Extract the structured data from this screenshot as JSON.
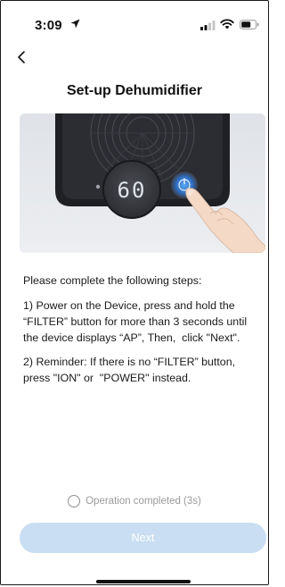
{
  "status_bar": {
    "time": "3:09"
  },
  "header": {
    "back_icon": "chevron-left-icon",
    "title": "Set-up Dehumidifier"
  },
  "hero": {
    "display_reading": "60"
  },
  "instructions": {
    "intro": "Please complete the following steps:",
    "step1": "1) Power on the Device, press and hold the “FILTER” button for more than 3 seconds until the device displays “AP”, Then,  click \"Next\".",
    "step2": "2) Reminder: If there is no “FILTER” button, press \"ION\" or  \"POWER\" instead."
  },
  "confirmation": {
    "label": "Operation completed (3s)",
    "checked": false
  },
  "actions": {
    "next_label": "Next",
    "next_enabled": false
  },
  "colors": {
    "next_button_bg": "#c9def2",
    "next_button_text": "#ffffff",
    "power_button_blue": "#3a8ee6"
  }
}
